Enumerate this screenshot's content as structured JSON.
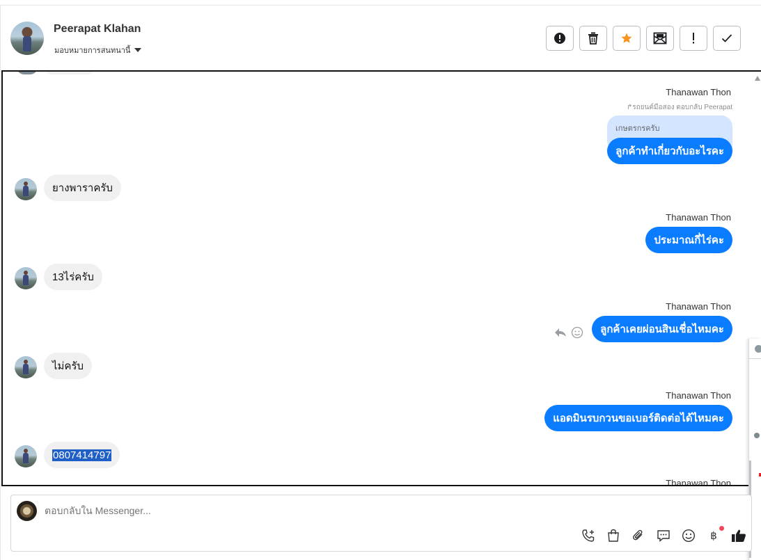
{
  "header": {
    "contact_name": "Peerapat Klahan",
    "assign_label": "มอบหมายการสนทนานี้"
  },
  "actions": [
    {
      "name": "report-spam-button",
      "icon": "alert-circle-icon"
    },
    {
      "name": "delete-button",
      "icon": "trash-icon"
    },
    {
      "name": "star-button",
      "icon": "star-icon",
      "color": "#f7931e"
    },
    {
      "name": "mark-unread-button",
      "icon": "envelope-icon"
    },
    {
      "name": "mark-important-button",
      "icon": "exclamation-icon"
    },
    {
      "name": "mark-done-button",
      "icon": "check-icon"
    }
  ],
  "messages": {
    "reply_meta": "↱รถยนต์มือสอง ตอบกลับ Peerapat",
    "quoted_text": "เกษตรกรครับ",
    "sender_name": "Thanawan Thon",
    "items": [
      {
        "direction": "out",
        "text": "ลูกค้าทำเกี่ยวกับอะไรคะ"
      },
      {
        "direction": "in",
        "text": "ยางพาราครับ"
      },
      {
        "direction": "out",
        "text": "ประมาณกี่ไร่คะ"
      },
      {
        "direction": "in",
        "text": "13ไร่ครับ"
      },
      {
        "direction": "out",
        "text": "ลูกค้าเคยผ่อนสินเชื่อไหมคะ"
      },
      {
        "direction": "in",
        "text": "ไม่ครับ"
      },
      {
        "direction": "out",
        "text": "แอดมินรบกวนขอเบอร์ติดต่อได้ไหมคะ"
      },
      {
        "direction": "in",
        "text": "0807414797"
      }
    ]
  },
  "composer": {
    "placeholder": "ตอบกลับใน Messenger...",
    "baht_symbol": "฿"
  },
  "colors": {
    "outgoing_bubble": "#0a7cff",
    "incoming_bubble": "#f0f0f0",
    "accent_star": "#f7931e",
    "notification_dot": "#f0475a"
  }
}
